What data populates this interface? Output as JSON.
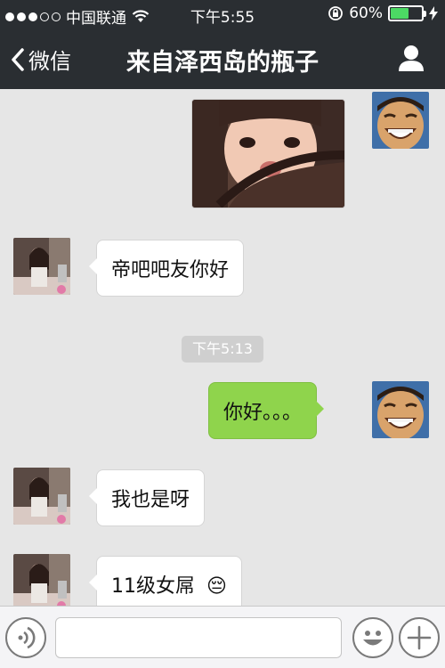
{
  "status_bar": {
    "carrier": "中国联通",
    "time": "下午5:55",
    "battery_text": "60%",
    "battery_level": 0.6
  },
  "nav": {
    "back_label": "微信",
    "title": "来自泽西岛的瓶子"
  },
  "messages": [
    {
      "sender": "me",
      "type": "image"
    },
    {
      "sender": "other",
      "type": "text",
      "text": "帝吧吧友你好"
    },
    {
      "sender": "system",
      "type": "timestamp",
      "text": "下午5:13"
    },
    {
      "sender": "me",
      "type": "text",
      "text": "你好。。。"
    },
    {
      "sender": "other",
      "type": "text",
      "text": "我也是呀"
    },
    {
      "sender": "other",
      "type": "text",
      "text": "11级女屌",
      "emoji": "😔"
    }
  ],
  "input_bar": {
    "voice_icon": "voice-icon",
    "emoji_icon": "smiley-icon",
    "more_icon": "plus-icon",
    "placeholder": ""
  },
  "colors": {
    "nav_background": "#2a2e32",
    "chat_background": "#e6e6e6",
    "outgoing_bubble": "#8fd44c",
    "incoming_bubble": "#ffffff",
    "battery_fill": "#4cd964"
  }
}
